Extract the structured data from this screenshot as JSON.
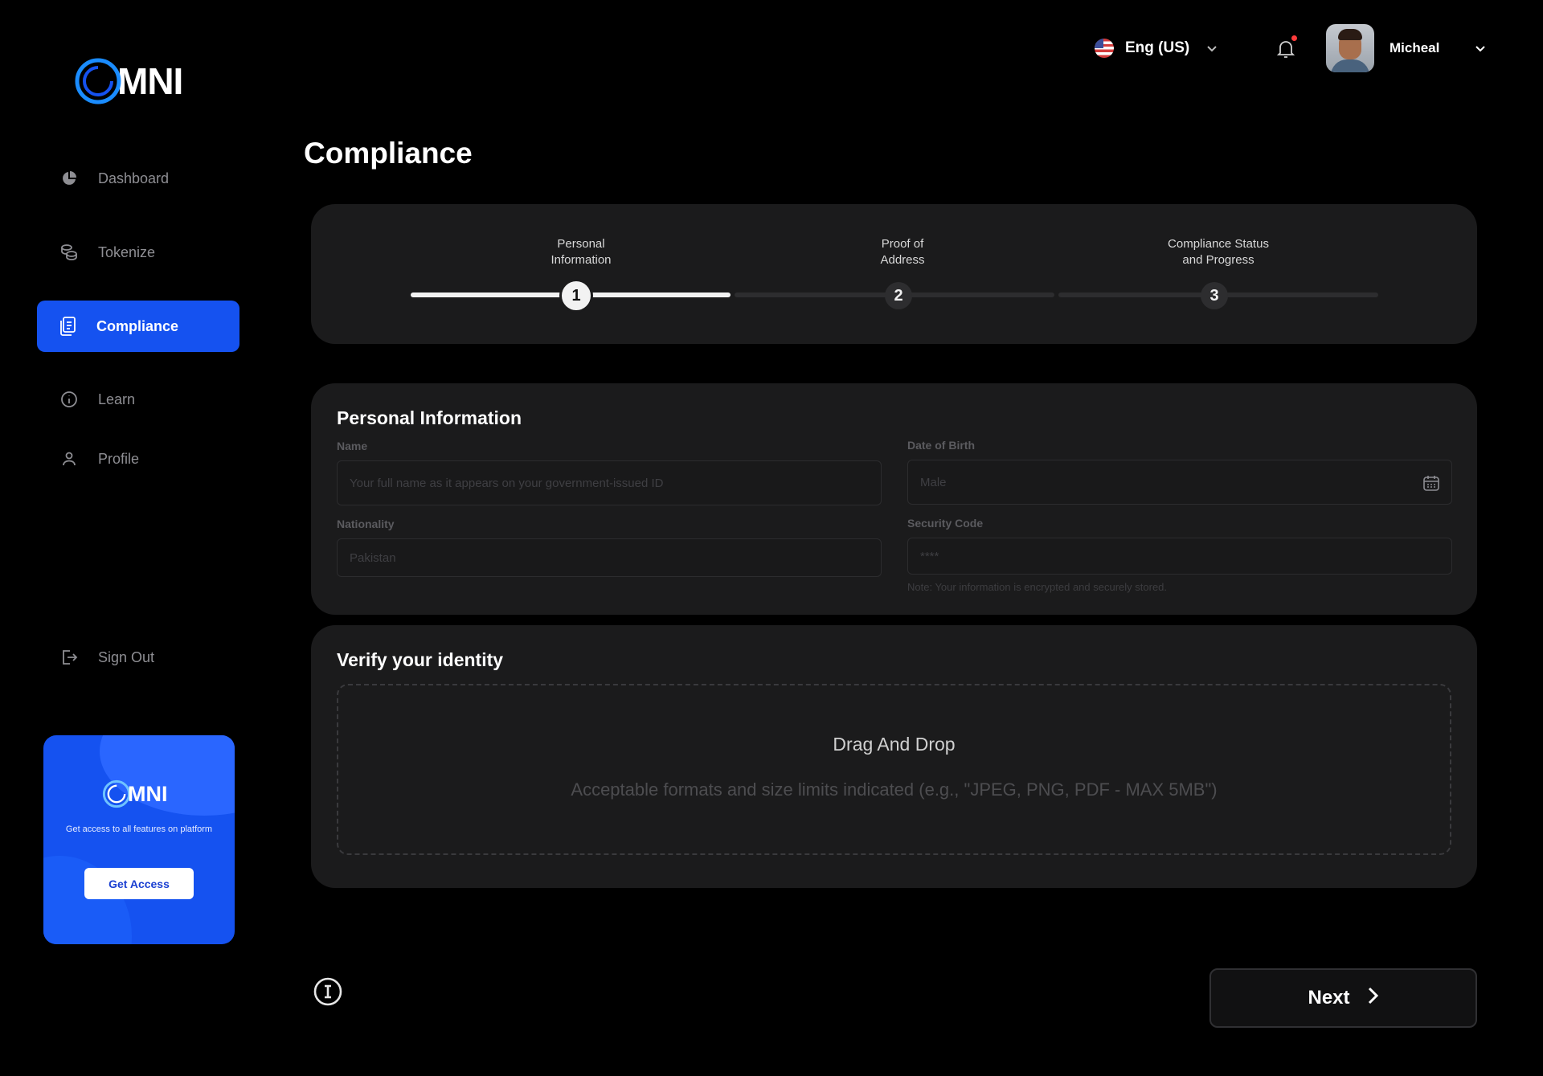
{
  "brand": {
    "name": "MNI",
    "accent": "#1552f0"
  },
  "sidebar": {
    "items": [
      {
        "label": "Dashboard",
        "icon": "pie-chart-icon"
      },
      {
        "label": "Tokenize",
        "icon": "coins-icon"
      },
      {
        "label": "Compliance",
        "icon": "documents-icon",
        "active": true
      },
      {
        "label": "Learn",
        "icon": "info-icon"
      },
      {
        "label": "Profile",
        "icon": "user-icon"
      }
    ],
    "signout": {
      "label": "Sign Out",
      "icon": "sign-out-icon"
    },
    "promo": {
      "brand": "MNI",
      "text": "Get access to all features on platform",
      "button": "Get Access"
    }
  },
  "topbar": {
    "language": "Eng (US)",
    "user_name": "Micheal",
    "has_notification": true
  },
  "page": {
    "title": "Compliance"
  },
  "stepper": {
    "steps": [
      {
        "label": "Personal\nInformation",
        "number": "1",
        "state": "current"
      },
      {
        "label": "Proof of\nAddress",
        "number": "2",
        "state": "todo"
      },
      {
        "label": "Compliance Status\nand Progress",
        "number": "3",
        "state": "todo"
      }
    ],
    "progress": 1.0
  },
  "personal_info": {
    "title": "Personal Information",
    "fields": {
      "name": {
        "label": "Name",
        "placeholder": "Your full name as it appears on your government-issued ID"
      },
      "dob": {
        "label": "Date of Birth",
        "value": "Male"
      },
      "nationality": {
        "label": "Nationality",
        "value": "Pakistan"
      },
      "security_code": {
        "label": "Security Code",
        "value": "****"
      }
    },
    "note": "Note: Your information is encrypted and securely stored."
  },
  "verify": {
    "title": "Verify your identity",
    "drop_title": "Drag And Drop",
    "drop_subtitle": "Acceptable formats and size limits indicated (e.g., \"JPEG, PNG, PDF - MAX 5MB\")"
  },
  "footer": {
    "next_label": "Next"
  }
}
